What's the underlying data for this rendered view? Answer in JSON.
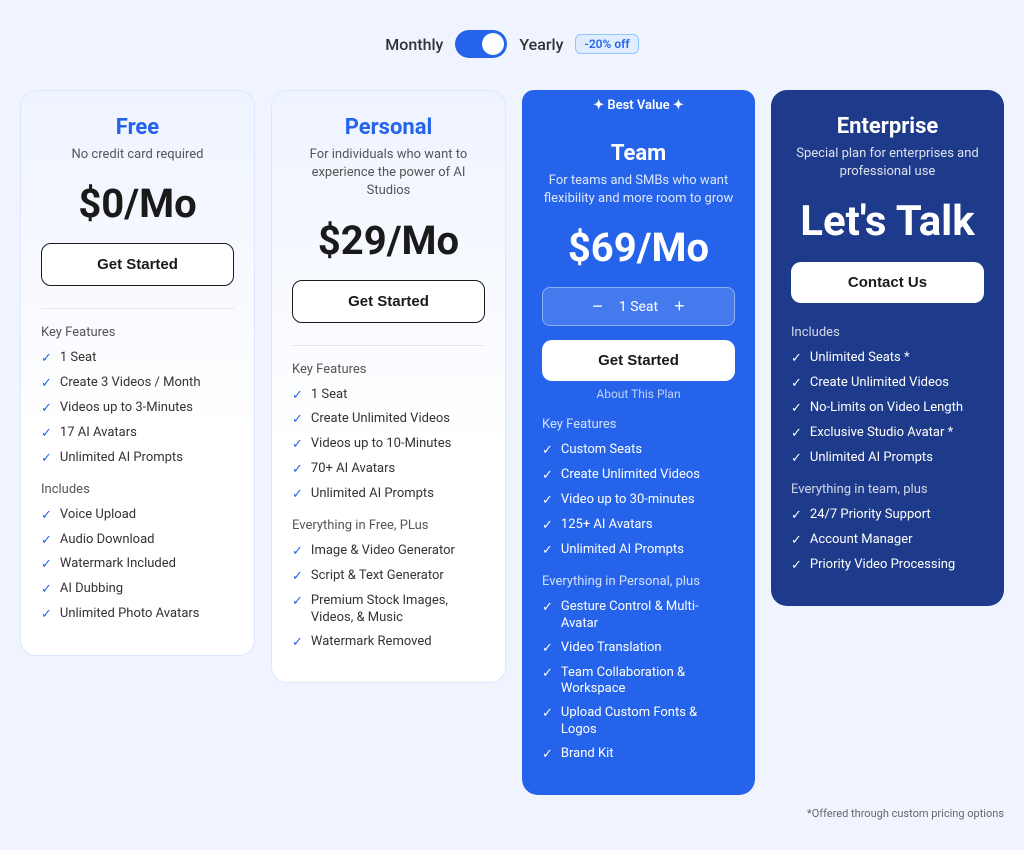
{
  "toggle": {
    "monthly_label": "Monthly",
    "yearly_label": "Yearly",
    "discount_badge": "-20% off"
  },
  "plans": [
    {
      "id": "free",
      "name": "Free",
      "description": "No credit card required",
      "price": "$0/Mo",
      "cta": "Get Started",
      "key_features_title": "Key Features",
      "key_features": [
        "1 Seat",
        "Create 3 Videos / Month",
        "Videos up to 3-Minutes",
        "17 AI Avatars",
        "Unlimited AI Prompts"
      ],
      "includes_title": "Includes",
      "includes": [
        "Voice Upload",
        "Audio Download",
        "Watermark Included",
        "AI Dubbing",
        "Unlimited Photo Avatars"
      ]
    },
    {
      "id": "personal",
      "name": "Personal",
      "description": "For individuals who want to experience the power of AI Studios",
      "price": "$29/Mo",
      "cta": "Get Started",
      "key_features_title": "Key Features",
      "key_features": [
        "1 Seat",
        "Create Unlimited Videos",
        "Videos up to 10-Minutes",
        "70+ AI Avatars",
        "Unlimited AI Prompts"
      ],
      "includes_title": "Everything in Free, PLus",
      "includes": [
        "Image & Video Generator",
        "Script & Text Generator",
        "Premium Stock Images, Videos, & Music",
        "Watermark Removed"
      ]
    },
    {
      "id": "team",
      "name": "Team",
      "description": "For teams and SMBs who want flexibility and more room to grow",
      "price": "$69/Mo",
      "seat_label": "1 Seat",
      "cta": "Get Started",
      "about": "About This Plan",
      "key_features_title": "Key Features",
      "key_features": [
        "Custom Seats",
        "Create Unlimited Videos",
        "Video up to 30-minutes",
        "125+ AI Avatars",
        "Unlimited AI Prompts"
      ],
      "includes_title": "Everything in Personal, plus",
      "includes": [
        "Gesture Control & Multi-Avatar",
        "Video Translation",
        "Team Collaboration & Workspace",
        "Upload Custom Fonts & Logos",
        "Brand Kit"
      ],
      "best_value": "✦ Best Value ✦",
      "is_featured": true
    },
    {
      "id": "enterprise",
      "name": "Enterprise",
      "description": "Special plan for enterprises and professional use",
      "price_alt": "Let's Talk",
      "cta": "Contact Us",
      "key_features_title": "Includes",
      "key_features": [
        "Unlimited Seats *",
        "Create Unlimited Videos",
        "No-Limits on Video Length",
        "Exclusive Studio Avatar *",
        "Unlimited AI Prompts"
      ],
      "includes_title": "Everything in team, plus",
      "includes": [
        "24/7 Priority Support",
        "Account Manager",
        "Priority Video Processing"
      ]
    }
  ],
  "footnote": "*Offered through custom pricing options"
}
